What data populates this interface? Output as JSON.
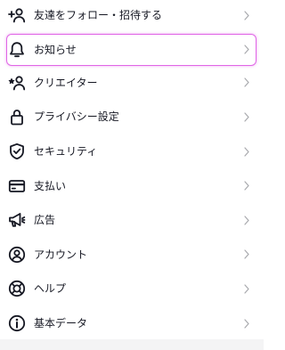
{
  "accent_color": "#e066e6",
  "menu": {
    "items": [
      {
        "label": "友達をフォロー・招待する",
        "icon": "add-user-icon"
      },
      {
        "label": "お知らせ",
        "icon": "bell-icon",
        "highlighted": true
      },
      {
        "label": "クリエイター",
        "icon": "creator-star-user-icon"
      },
      {
        "label": "プライバシー設定",
        "icon": "lock-icon"
      },
      {
        "label": "セキュリティ",
        "icon": "shield-check-icon"
      },
      {
        "label": "支払い",
        "icon": "credit-card-icon"
      },
      {
        "label": "広告",
        "icon": "megaphone-icon"
      },
      {
        "label": "アカウント",
        "icon": "account-circle-icon"
      },
      {
        "label": "ヘルプ",
        "icon": "lifebuoy-icon"
      },
      {
        "label": "基本データ",
        "icon": "info-circle-icon"
      }
    ]
  }
}
